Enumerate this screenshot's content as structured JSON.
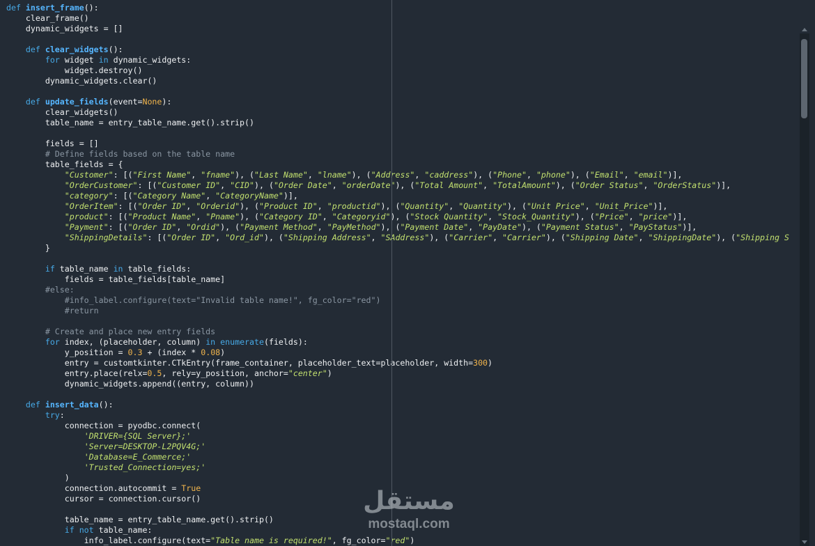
{
  "code_lines": [
    [
      {
        "c": "kw",
        "t": "def "
      },
      {
        "c": "fn",
        "t": "insert_frame"
      },
      {
        "c": "",
        "t": "():"
      }
    ],
    [
      {
        "c": "",
        "t": "    clear_frame()"
      }
    ],
    [
      {
        "c": "",
        "t": "    dynamic_widgets = []"
      }
    ],
    [],
    [
      {
        "c": "",
        "t": "    "
      },
      {
        "c": "kw",
        "t": "def "
      },
      {
        "c": "fn",
        "t": "clear_widgets"
      },
      {
        "c": "",
        "t": "():"
      }
    ],
    [
      {
        "c": "",
        "t": "        "
      },
      {
        "c": "kw",
        "t": "for"
      },
      {
        "c": "",
        "t": " widget "
      },
      {
        "c": "kw",
        "t": "in"
      },
      {
        "c": "",
        "t": " dynamic_widgets:"
      }
    ],
    [
      {
        "c": "",
        "t": "            widget.destroy()"
      }
    ],
    [
      {
        "c": "",
        "t": "        dynamic_widgets.clear()"
      }
    ],
    [],
    [
      {
        "c": "",
        "t": "    "
      },
      {
        "c": "kw",
        "t": "def "
      },
      {
        "c": "fn",
        "t": "update_fields"
      },
      {
        "c": "",
        "t": "(event="
      },
      {
        "c": "nm",
        "t": "None"
      },
      {
        "c": "",
        "t": "):"
      }
    ],
    [
      {
        "c": "",
        "t": "        clear_widgets()"
      }
    ],
    [
      {
        "c": "",
        "t": "        table_name = entry_table_name.get().strip()"
      }
    ],
    [],
    [
      {
        "c": "",
        "t": "        fields = []"
      }
    ],
    [
      {
        "c": "",
        "t": "        "
      },
      {
        "c": "cm",
        "t": "# Define fields based on the table name"
      }
    ],
    [
      {
        "c": "",
        "t": "        table_fields = {"
      }
    ],
    [
      {
        "c": "",
        "t": "            "
      },
      {
        "c": "st",
        "t": "\"Customer\""
      },
      {
        "c": "",
        "t": ": [("
      },
      {
        "c": "st",
        "t": "\"First Name\""
      },
      {
        "c": "",
        "t": ", "
      },
      {
        "c": "st",
        "t": "\"fname\""
      },
      {
        "c": "",
        "t": "), ("
      },
      {
        "c": "st",
        "t": "\"Last Name\""
      },
      {
        "c": "",
        "t": ", "
      },
      {
        "c": "st",
        "t": "\"lname\""
      },
      {
        "c": "",
        "t": "), ("
      },
      {
        "c": "st",
        "t": "\"Address\""
      },
      {
        "c": "",
        "t": ", "
      },
      {
        "c": "st",
        "t": "\"caddress\""
      },
      {
        "c": "",
        "t": "), ("
      },
      {
        "c": "st",
        "t": "\"Phone\""
      },
      {
        "c": "",
        "t": ", "
      },
      {
        "c": "st",
        "t": "\"phone\""
      },
      {
        "c": "",
        "t": "), ("
      },
      {
        "c": "st",
        "t": "\"Email\""
      },
      {
        "c": "",
        "t": ", "
      },
      {
        "c": "st",
        "t": "\"email\""
      },
      {
        "c": "",
        "t": ")],"
      }
    ],
    [
      {
        "c": "",
        "t": "            "
      },
      {
        "c": "st",
        "t": "\"OrderCustomer\""
      },
      {
        "c": "",
        "t": ": [("
      },
      {
        "c": "st",
        "t": "\"Customer ID\""
      },
      {
        "c": "",
        "t": ", "
      },
      {
        "c": "st",
        "t": "\"CID\""
      },
      {
        "c": "",
        "t": "), ("
      },
      {
        "c": "st",
        "t": "\"Order Date\""
      },
      {
        "c": "",
        "t": ", "
      },
      {
        "c": "st",
        "t": "\"orderDate\""
      },
      {
        "c": "",
        "t": "), ("
      },
      {
        "c": "st",
        "t": "\"Total Amount\""
      },
      {
        "c": "",
        "t": ", "
      },
      {
        "c": "st",
        "t": "\"TotalAmount\""
      },
      {
        "c": "",
        "t": "), ("
      },
      {
        "c": "st",
        "t": "\"Order Status\""
      },
      {
        "c": "",
        "t": ", "
      },
      {
        "c": "st",
        "t": "\"OrderStatus\""
      },
      {
        "c": "",
        "t": ")],"
      }
    ],
    [
      {
        "c": "",
        "t": "            "
      },
      {
        "c": "st",
        "t": "\"category\""
      },
      {
        "c": "",
        "t": ": [("
      },
      {
        "c": "st",
        "t": "\"Category Name\""
      },
      {
        "c": "",
        "t": ", "
      },
      {
        "c": "st",
        "t": "\"CategoryName\""
      },
      {
        "c": "",
        "t": ")],"
      }
    ],
    [
      {
        "c": "",
        "t": "            "
      },
      {
        "c": "st",
        "t": "\"OrderItem\""
      },
      {
        "c": "",
        "t": ": [("
      },
      {
        "c": "st",
        "t": "\"Order ID\""
      },
      {
        "c": "",
        "t": ", "
      },
      {
        "c": "st",
        "t": "\"Orderid\""
      },
      {
        "c": "",
        "t": "), ("
      },
      {
        "c": "st",
        "t": "\"Product ID\""
      },
      {
        "c": "",
        "t": ", "
      },
      {
        "c": "st",
        "t": "\"productid\""
      },
      {
        "c": "",
        "t": "), ("
      },
      {
        "c": "st",
        "t": "\"Quantity\""
      },
      {
        "c": "",
        "t": ", "
      },
      {
        "c": "st",
        "t": "\"Quantity\""
      },
      {
        "c": "",
        "t": "), ("
      },
      {
        "c": "st",
        "t": "\"Unit Price\""
      },
      {
        "c": "",
        "t": ", "
      },
      {
        "c": "st",
        "t": "\"Unit_Price\""
      },
      {
        "c": "",
        "t": ")],"
      }
    ],
    [
      {
        "c": "",
        "t": "            "
      },
      {
        "c": "st",
        "t": "\"product\""
      },
      {
        "c": "",
        "t": ": [("
      },
      {
        "c": "st",
        "t": "\"Product Name\""
      },
      {
        "c": "",
        "t": ", "
      },
      {
        "c": "st",
        "t": "\"Pname\""
      },
      {
        "c": "",
        "t": "), ("
      },
      {
        "c": "st",
        "t": "\"Category ID\""
      },
      {
        "c": "",
        "t": ", "
      },
      {
        "c": "st",
        "t": "\"Categoryid\""
      },
      {
        "c": "",
        "t": "), ("
      },
      {
        "c": "st",
        "t": "\"Stock Quantity\""
      },
      {
        "c": "",
        "t": ", "
      },
      {
        "c": "st",
        "t": "\"Stock_Quantity\""
      },
      {
        "c": "",
        "t": "), ("
      },
      {
        "c": "st",
        "t": "\"Price\""
      },
      {
        "c": "",
        "t": ", "
      },
      {
        "c": "st",
        "t": "\"price\""
      },
      {
        "c": "",
        "t": ")],"
      }
    ],
    [
      {
        "c": "",
        "t": "            "
      },
      {
        "c": "st",
        "t": "\"Payment\""
      },
      {
        "c": "",
        "t": ": [("
      },
      {
        "c": "st",
        "t": "\"Order ID\""
      },
      {
        "c": "",
        "t": ", "
      },
      {
        "c": "st",
        "t": "\"Ordid\""
      },
      {
        "c": "",
        "t": "), ("
      },
      {
        "c": "st",
        "t": "\"Payment Method\""
      },
      {
        "c": "",
        "t": ", "
      },
      {
        "c": "st",
        "t": "\"PayMethod\""
      },
      {
        "c": "",
        "t": "), ("
      },
      {
        "c": "st",
        "t": "\"Payment Date\""
      },
      {
        "c": "",
        "t": ", "
      },
      {
        "c": "st",
        "t": "\"PayDate\""
      },
      {
        "c": "",
        "t": "), ("
      },
      {
        "c": "st",
        "t": "\"Payment Status\""
      },
      {
        "c": "",
        "t": ", "
      },
      {
        "c": "st",
        "t": "\"PayStatus\""
      },
      {
        "c": "",
        "t": ")],"
      }
    ],
    [
      {
        "c": "",
        "t": "            "
      },
      {
        "c": "st",
        "t": "\"ShippingDetails\""
      },
      {
        "c": "",
        "t": ": [("
      },
      {
        "c": "st",
        "t": "\"Order ID\""
      },
      {
        "c": "",
        "t": ", "
      },
      {
        "c": "st",
        "t": "\"Ord_id\""
      },
      {
        "c": "",
        "t": "), ("
      },
      {
        "c": "st",
        "t": "\"Shipping Address\""
      },
      {
        "c": "",
        "t": ", "
      },
      {
        "c": "st",
        "t": "\"SAddress\""
      },
      {
        "c": "",
        "t": "), ("
      },
      {
        "c": "st",
        "t": "\"Carrier\""
      },
      {
        "c": "",
        "t": ", "
      },
      {
        "c": "st",
        "t": "\"Carrier\""
      },
      {
        "c": "",
        "t": "), ("
      },
      {
        "c": "st",
        "t": "\"Shipping Date\""
      },
      {
        "c": "",
        "t": ", "
      },
      {
        "c": "st",
        "t": "\"ShippingDate\""
      },
      {
        "c": "",
        "t": "), ("
      },
      {
        "c": "st",
        "t": "\"Shipping S"
      }
    ],
    [
      {
        "c": "",
        "t": "        }"
      }
    ],
    [],
    [
      {
        "c": "",
        "t": "        "
      },
      {
        "c": "kw",
        "t": "if"
      },
      {
        "c": "",
        "t": " table_name "
      },
      {
        "c": "kw",
        "t": "in"
      },
      {
        "c": "",
        "t": " table_fields:"
      }
    ],
    [
      {
        "c": "",
        "t": "            fields = table_fields[table_name]"
      }
    ],
    [
      {
        "c": "",
        "t": "        "
      },
      {
        "c": "cm",
        "t": "#else:"
      }
    ],
    [
      {
        "c": "",
        "t": "            "
      },
      {
        "c": "cm",
        "t": "#info_label.configure(text=\"Invalid table name!\", fg_color=\"red\")"
      }
    ],
    [
      {
        "c": "",
        "t": "            "
      },
      {
        "c": "cm",
        "t": "#return"
      }
    ],
    [],
    [
      {
        "c": "",
        "t": "        "
      },
      {
        "c": "cm",
        "t": "# Create and place new entry fields"
      }
    ],
    [
      {
        "c": "",
        "t": "        "
      },
      {
        "c": "kw",
        "t": "for"
      },
      {
        "c": "",
        "t": " index, (placeholder, column) "
      },
      {
        "c": "kw",
        "t": "in"
      },
      {
        "c": "",
        "t": " "
      },
      {
        "c": "kw",
        "t": "enumerate"
      },
      {
        "c": "",
        "t": "(fields):"
      }
    ],
    [
      {
        "c": "",
        "t": "            y_position = "
      },
      {
        "c": "nm",
        "t": "0.3"
      },
      {
        "c": "",
        "t": " + (index * "
      },
      {
        "c": "nm",
        "t": "0.08"
      },
      {
        "c": "",
        "t": ")"
      }
    ],
    [
      {
        "c": "",
        "t": "            entry = customtkinter.CTkEntry(frame_container, placeholder_text=placeholder, width="
      },
      {
        "c": "nm",
        "t": "300"
      },
      {
        "c": "",
        "t": ")"
      }
    ],
    [
      {
        "c": "",
        "t": "            entry.place(relx="
      },
      {
        "c": "nm",
        "t": "0.5"
      },
      {
        "c": "",
        "t": ", rely=y_position, anchor="
      },
      {
        "c": "st",
        "t": "\"center\""
      },
      {
        "c": "",
        "t": ")"
      }
    ],
    [
      {
        "c": "",
        "t": "            dynamic_widgets.append((entry, column))"
      }
    ],
    [],
    [
      {
        "c": "",
        "t": "    "
      },
      {
        "c": "kw",
        "t": "def "
      },
      {
        "c": "fn",
        "t": "insert_data"
      },
      {
        "c": "",
        "t": "():"
      }
    ],
    [
      {
        "c": "",
        "t": "        "
      },
      {
        "c": "kw",
        "t": "try"
      },
      {
        "c": "",
        "t": ":"
      }
    ],
    [
      {
        "c": "",
        "t": "            connection = pyodbc.connect("
      }
    ],
    [
      {
        "c": "",
        "t": "                "
      },
      {
        "c": "st",
        "t": "'DRIVER={SQL Server};'"
      }
    ],
    [
      {
        "c": "",
        "t": "                "
      },
      {
        "c": "st",
        "t": "'Server=DESKTOP-L2PQV4G;'"
      }
    ],
    [
      {
        "c": "",
        "t": "                "
      },
      {
        "c": "st",
        "t": "'Database=E_Commerce;'"
      }
    ],
    [
      {
        "c": "",
        "t": "                "
      },
      {
        "c": "st",
        "t": "'Trusted_Connection=yes;'"
      }
    ],
    [
      {
        "c": "",
        "t": "            )"
      }
    ],
    [
      {
        "c": "",
        "t": "            connection.autocommit = "
      },
      {
        "c": "nm",
        "t": "True"
      }
    ],
    [
      {
        "c": "",
        "t": "            cursor = connection.cursor()"
      }
    ],
    [],
    [
      {
        "c": "",
        "t": "            table_name = entry_table_name.get().strip()"
      }
    ],
    [
      {
        "c": "",
        "t": "            "
      },
      {
        "c": "kw",
        "t": "if not"
      },
      {
        "c": "",
        "t": " table_name:"
      }
    ],
    [
      {
        "c": "",
        "t": "                info_label.configure(text="
      },
      {
        "c": "st",
        "t": "\"Table name is required!\""
      },
      {
        "c": "",
        "t": ", fg_color="
      },
      {
        "c": "st",
        "t": "\"red\""
      },
      {
        "c": "",
        "t": ")"
      }
    ]
  ],
  "watermark": {
    "arabic": "مستقل",
    "latin": "mostaql.com"
  },
  "colors": {
    "background": "#232b35",
    "keyword": "#47a9e6",
    "function_name": "#56b6ff",
    "string": "#c2e06f",
    "number": "#f0b44c",
    "comment": "#8a96a2",
    "text": "#eef0f2"
  }
}
